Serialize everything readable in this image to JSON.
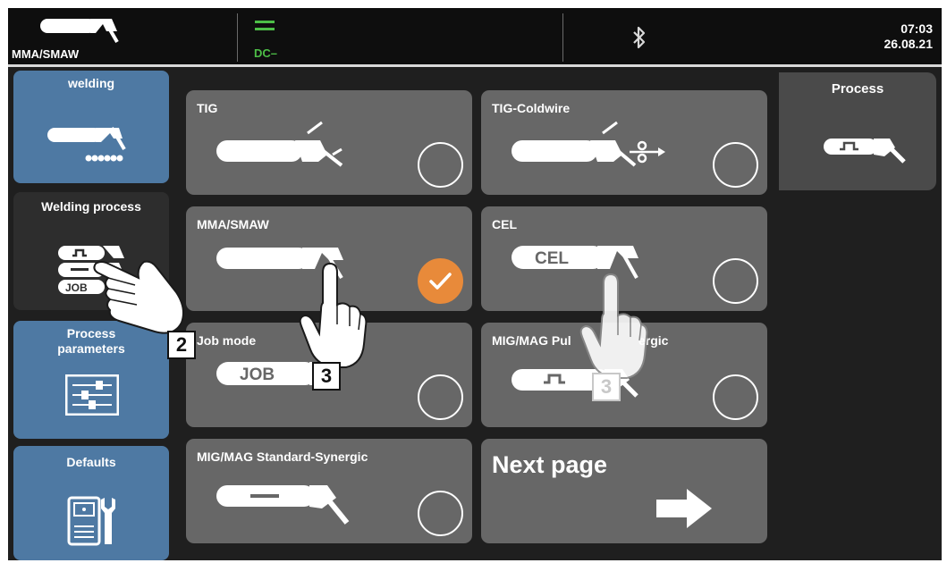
{
  "status_bar": {
    "mode_label": "MMA/SMAW",
    "current_label": "DC–",
    "time": "07:03",
    "date": "26.08.21",
    "bluetooth_icon": "bluetooth-icon"
  },
  "sidebar": {
    "items": [
      {
        "label": "welding",
        "icon": "welding-electrode-icon",
        "active": false
      },
      {
        "label": "Welding process",
        "icon": "process-stack-icon",
        "active": true,
        "icon_text": "JOB"
      },
      {
        "label": "Process\nparameters",
        "icon": "sliders-icon",
        "active": false
      },
      {
        "label": "Defaults",
        "icon": "machine-wrench-icon",
        "active": false
      }
    ]
  },
  "tiles": [
    {
      "label": "TIG",
      "icon": "tig-torch-icon",
      "selected": false
    },
    {
      "label": "TIG-Coldwire",
      "icon": "tig-coldwire-icon",
      "selected": false
    },
    {
      "label": "MMA/SMAW",
      "icon": "mma-electrode-icon",
      "selected": true
    },
    {
      "label": "CEL",
      "icon": "cel-electrode-icon",
      "selected": false,
      "icon_text": "CEL"
    },
    {
      "label": "Job mode",
      "icon": "job-icon",
      "selected": false,
      "icon_text": "JOB"
    },
    {
      "label": "MIG/MAG Pul",
      "label_end": "ergic",
      "icon": "pulse-torch-icon",
      "selected": false
    },
    {
      "label": "MIG/MAG Standard-Synergic",
      "icon": "standard-torch-icon",
      "selected": false
    },
    {
      "label": "Next page",
      "icon": "arrow-right-icon"
    }
  ],
  "right_panel": {
    "title": "Process",
    "icon": "pulse-torch-icon"
  },
  "callouts": [
    "2",
    "3",
    "3"
  ],
  "colors": {
    "accent_orange": "#e88a3a",
    "nav_blue": "#4e79a3",
    "dc_green": "#4dbe47",
    "tile_gray": "#676767"
  }
}
